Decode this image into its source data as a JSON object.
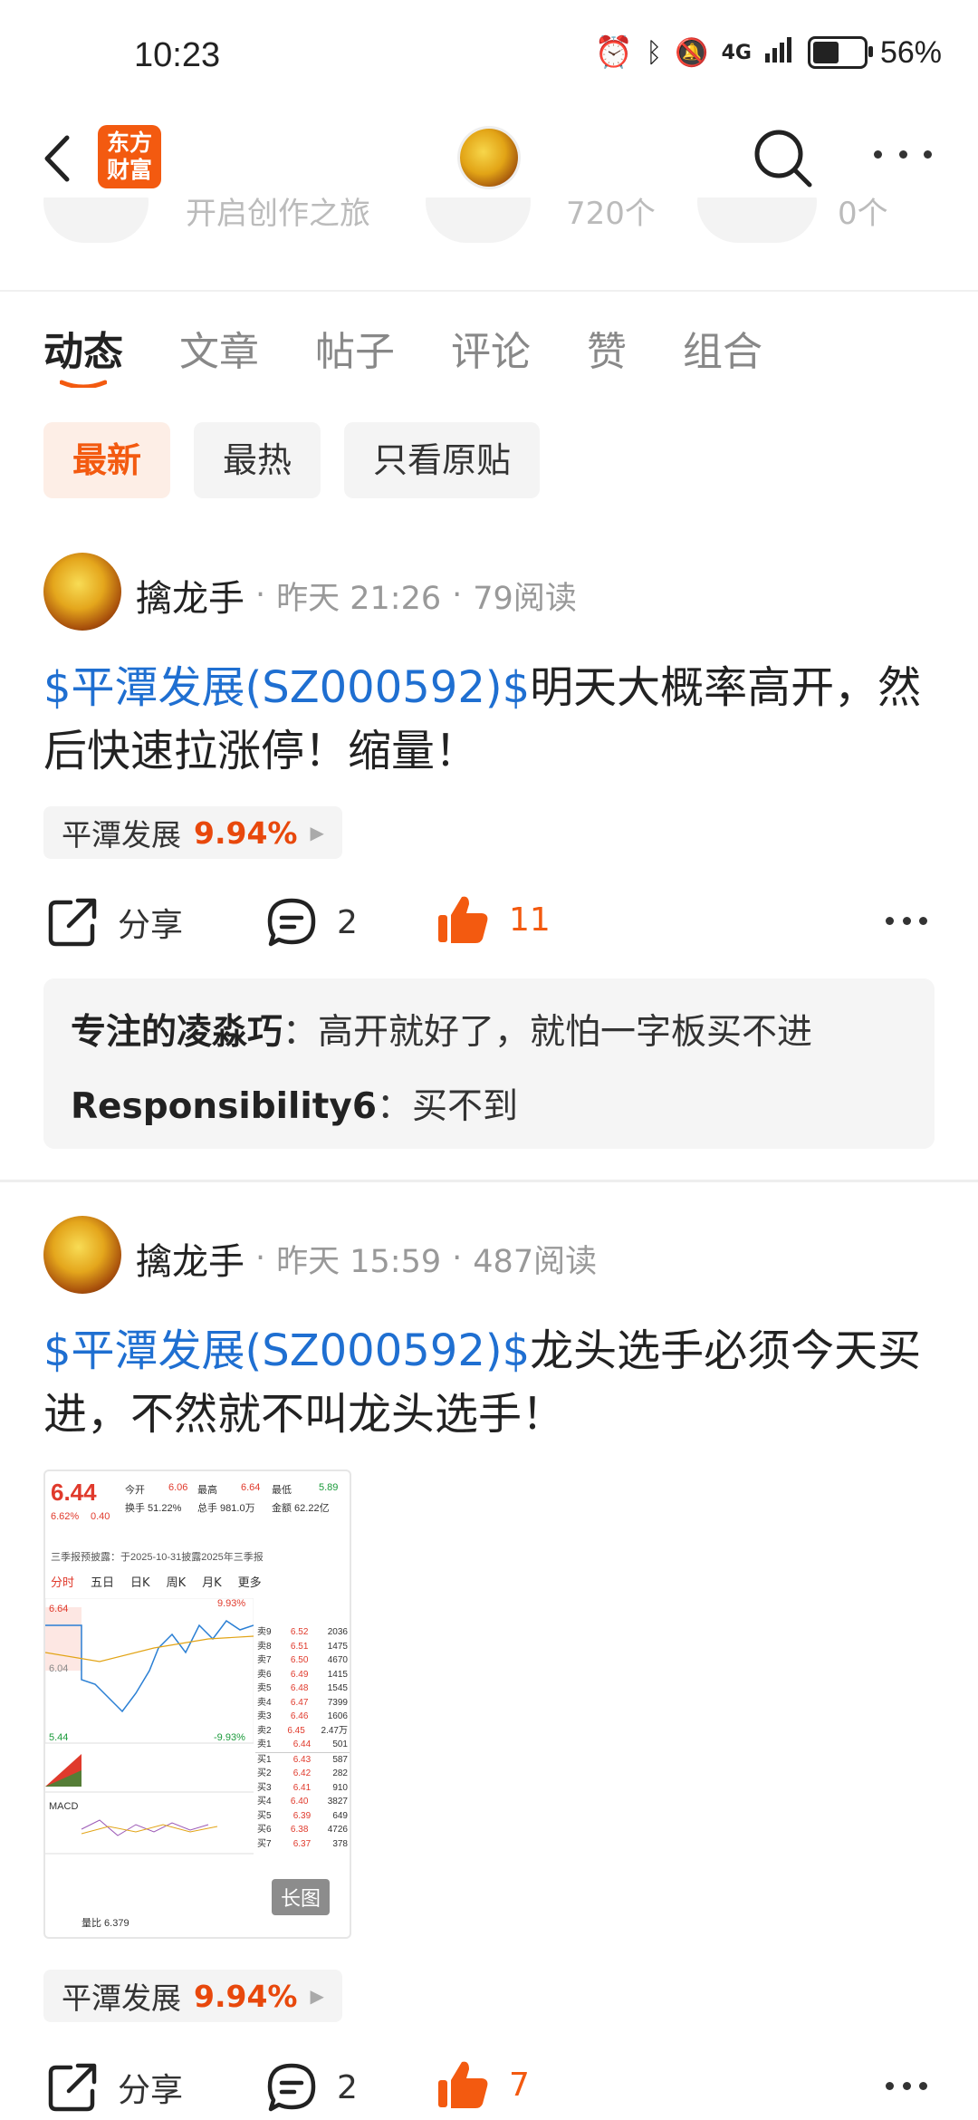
{
  "status_bar": {
    "time": "10:23",
    "battery": "56%",
    "battery_level": 0.56,
    "signal": "4G"
  },
  "header": {
    "logo_line1": "东方",
    "logo_line2": "财富"
  },
  "stats_row": {
    "creative": "开启创作之旅",
    "count1": "720个",
    "count2": "0个"
  },
  "tabs": [
    "动态",
    "文章",
    "帖子",
    "评论",
    "赞",
    "组合"
  ],
  "filters": [
    "最新",
    "最热",
    "只看原贴"
  ],
  "posts": [
    {
      "username": "擒龙手",
      "time": "昨天 21:26",
      "reads": "79阅读",
      "stock_link": "$平潭发展(SZ000592)$",
      "text": "明天大概率高开，然后快速拉涨停！缩量！",
      "tag_name": "平潭发展",
      "tag_pct": "9.94%",
      "share_label": "分享",
      "comment_count": "2",
      "like_count": "11",
      "comments": [
        {
          "author": "专注的凌淼巧",
          "text": "高开就好了，就怕一字板买不进"
        },
        {
          "author": "Responsibility6",
          "text": "买不到"
        }
      ]
    },
    {
      "username": "擒龙手",
      "time": "昨天 15:59",
      "reads": "487阅读",
      "stock_link": "$平潭发展(SZ000592)$",
      "text": "龙头选手必须今天买进，不然就不叫龙头选手！",
      "tag_name": "平潭发展",
      "tag_pct": "9.94%",
      "share_label": "分享",
      "comment_count": "2",
      "like_count": "7",
      "image_badge": "长图"
    }
  ],
  "thumbnail": {
    "price": "6.44",
    "change_pct": "6.62%",
    "change_abs": "0.40",
    "open_label": "今开",
    "open": "6.06",
    "high_label": "最高",
    "high": "6.64",
    "low_label": "最低",
    "low": "5.89",
    "turnover": "换手 51.22%",
    "volume": "总手 981.0万",
    "amount": "金额 62.22亿",
    "tabs": [
      "分时",
      "五日",
      "日K",
      "周K",
      "月K",
      "更多"
    ],
    "notice": "三季报预披露：于2025-10-31披露2025年三季报",
    "lvl_high": "6.64",
    "lvl_mid": "6.04",
    "lvl_low": "5.44",
    "pct_high": "9.93%",
    "pct_low": "-9.93%",
    "order_book": [
      [
        "卖9",
        "6.52",
        "2036"
      ],
      [
        "卖8",
        "6.51",
        "1475"
      ],
      [
        "卖7",
        "6.50",
        "4670"
      ],
      [
        "卖6",
        "6.49",
        "1415"
      ],
      [
        "卖5",
        "6.48",
        "1545"
      ],
      [
        "卖4",
        "6.47",
        "7399"
      ],
      [
        "卖3",
        "6.46",
        "1606"
      ],
      [
        "卖2",
        "6.45",
        "2.47万"
      ],
      [
        "卖1",
        "6.44",
        "501"
      ],
      [
        "买1",
        "6.43",
        "587"
      ],
      [
        "买2",
        "6.42",
        "282"
      ],
      [
        "买3",
        "6.41",
        "910"
      ],
      [
        "买4",
        "6.40",
        "3827"
      ],
      [
        "买5",
        "6.39",
        "649"
      ],
      [
        "买6",
        "6.38",
        "4726"
      ],
      [
        "买7",
        "6.37",
        "378"
      ]
    ],
    "macd": "MACD",
    "ratio": "量比 6.379"
  }
}
